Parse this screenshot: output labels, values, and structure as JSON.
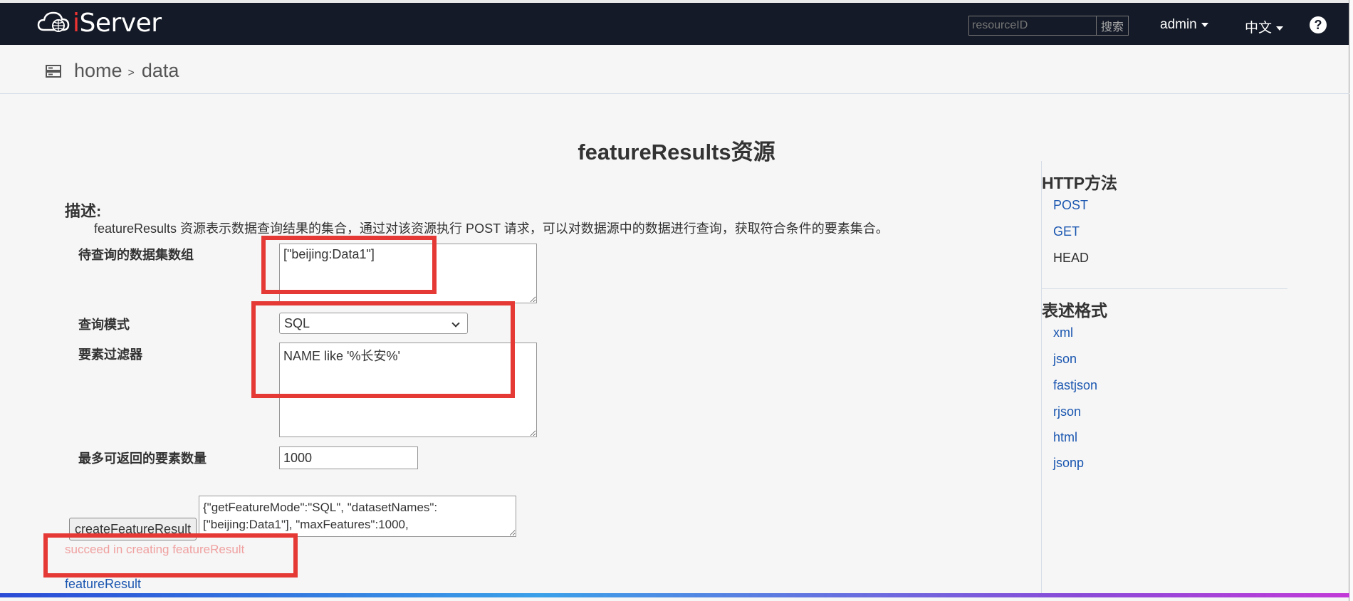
{
  "topbar": {
    "brand": "Server",
    "brand_prefix": "i",
    "search_placeholder": "resourceID",
    "search_button": "搜索",
    "user": "admin",
    "language": "中文",
    "help": "?"
  },
  "breadcrumb": {
    "items": [
      "home",
      "data"
    ],
    "separator": ">"
  },
  "page": {
    "title": "featureResults资源"
  },
  "description": {
    "title": "描述:",
    "text": "featureResults 资源表示数据查询结果的集合，通过对该资源执行 POST 请求，可以对数据源中的数据进行查询，获取符合条件的要素集合。"
  },
  "form": {
    "dataset_label": "待查询的数据集数组",
    "dataset_value": "[\"beijing:Data1\"]",
    "mode_label": "查询模式",
    "mode_value": "SQL",
    "filter_label": "要素过滤器",
    "filter_value": "NAME like '%长安%'",
    "max_label": "最多可返回的要素数量",
    "max_value": "1000",
    "create_button": "createFeatureResult",
    "request_body": "{\"getFeatureMode\":\"SQL\", \"datasetNames\":[\"beijing:Data1\"], \"maxFeatures\":1000,",
    "status": "succeed in creating featureResult",
    "result_link": "featureResult"
  },
  "sidebar": {
    "http_title": "HTTP方法",
    "http_methods": [
      "POST",
      "GET",
      "HEAD"
    ],
    "format_title": "表述格式",
    "formats": [
      "xml",
      "json",
      "fastjson",
      "rjson",
      "html",
      "jsonp"
    ]
  },
  "colors": {
    "nav_bg": "#141a27",
    "link": "#1a56b0",
    "highlight": "#e53935",
    "status": "#f0a0a0"
  }
}
